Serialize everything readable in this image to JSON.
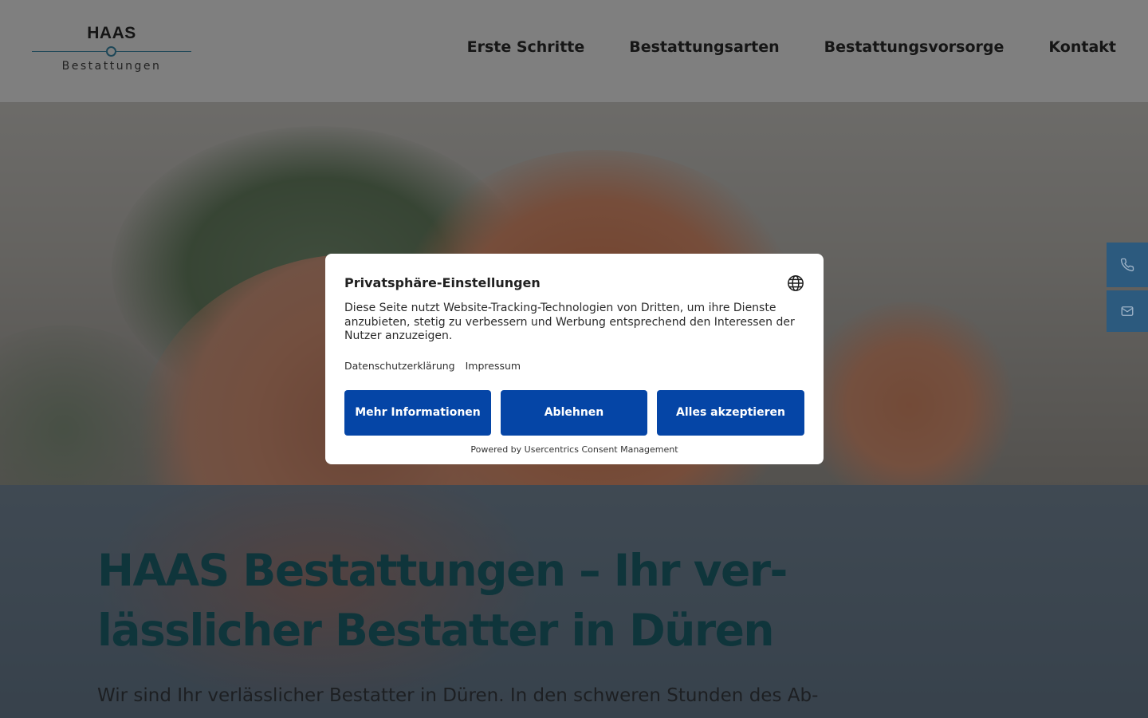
{
  "header": {
    "logo": {
      "name": "HAAS",
      "subtitle": "Bestattungen"
    },
    "nav": [
      {
        "label": "Erste Schritte"
      },
      {
        "label": "Bestattungsarten"
      },
      {
        "label": "Bestattungsvorsorge"
      },
      {
        "label": "Kontakt"
      }
    ]
  },
  "hero": {
    "headline_line1": "HAAS Bestattungen – Ihr ver-",
    "headline_line2": "lässlicher Bestatter in Düren",
    "intro": "Wir sind Ihr verlässlicher Bestatter in Düren. In den schweren Stunden des Ab-"
  },
  "side_contact": {
    "phone_icon": "phone-icon",
    "mail_icon": "mail-icon",
    "color": "#2c5a7e"
  },
  "consent": {
    "title": "Privatsphäre-Einstellungen",
    "description": "Diese Seite nutzt Website-Tracking-Technologien von Dritten, um ihre Dienste anzubieten, stetig zu verbessern und Werbung entsprechend den Interessen der Nutzer anzuzeigen.",
    "links": {
      "privacy": "Datenschutzerklärung",
      "imprint": "Impressum"
    },
    "buttons": {
      "more_info": "Mehr Informationen",
      "deny": "Ablehnen",
      "accept_all": "Alles akzeptieren"
    },
    "powered_by": "Powered by Usercentrics Consent Management",
    "button_color": "#0545a6",
    "language_icon": "globe-icon"
  },
  "colors": {
    "headline": "#1f6b76",
    "accent": "#3d8fb0"
  }
}
